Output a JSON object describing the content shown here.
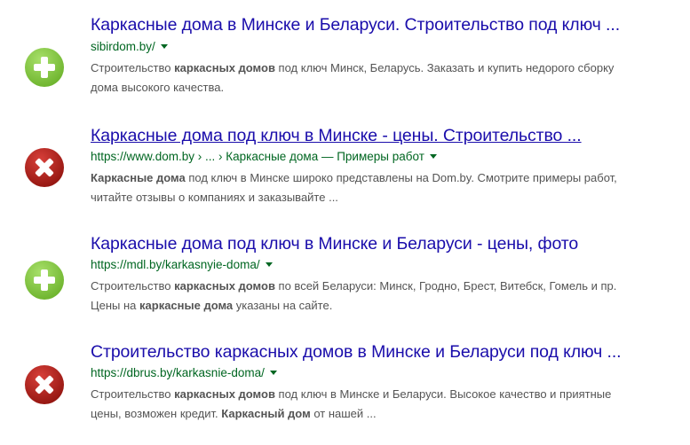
{
  "results": [
    {
      "status_icon": "plus-icon",
      "status_color": "#7cc242",
      "title": "Каркасные дома в Минске и Беларуси. Строительство под ключ ...",
      "url": "sibirdom.by/",
      "snippet_line1": [
        {
          "text": "Строительство ",
          "bold": false
        },
        {
          "text": "каркасных домов",
          "bold": true
        },
        {
          "text": " под ключ Минск, Беларусь. Заказать и купить недорого сборку",
          "bold": false
        }
      ],
      "snippet_line2": [
        {
          "text": "дома высокого качества.",
          "bold": false
        }
      ]
    },
    {
      "status_icon": "x-icon",
      "status_color": "#b0221c",
      "title": "Каркасные дома под ключ в Минске - цены. Строительство ...",
      "url": "https://www.dom.by › ... › Каркасные дома — Примеры работ",
      "snippet_line1": [
        {
          "text": "Каркасные дома",
          "bold": true
        },
        {
          "text": " под ключ в Минске широко представлены на Dom.by. Смотрите примеры работ,",
          "bold": false
        }
      ],
      "snippet_line2": [
        {
          "text": "читайте отзывы о компаниях и заказывайте ...",
          "bold": false
        }
      ]
    },
    {
      "status_icon": "plus-icon",
      "status_color": "#7cc242",
      "title": "Каркасные дома под ключ в Минске и Беларуси - цены, фото",
      "url": "https://mdl.by/karkasnyie-doma/",
      "snippet_line1": [
        {
          "text": "Строительство ",
          "bold": false
        },
        {
          "text": "каркасных домов",
          "bold": true
        },
        {
          "text": " по всей Беларуси: Минск, Гродно, Брест, Витебск, Гомель и пр.",
          "bold": false
        }
      ],
      "snippet_line2": [
        {
          "text": "Цены на ",
          "bold": false
        },
        {
          "text": "каркасные дома",
          "bold": true
        },
        {
          "text": " указаны на сайте.",
          "bold": false
        }
      ]
    },
    {
      "status_icon": "x-icon",
      "status_color": "#b0221c",
      "title": "Строительство каркасных домов в Минске и Беларуси под ключ ...",
      "url": "https://dbrus.by/karkasnie-doma/",
      "snippet_line1": [
        {
          "text": "Строительство ",
          "bold": false
        },
        {
          "text": "каркасных домов",
          "bold": true
        },
        {
          "text": " под ключ в Минске и Беларуси. Высокое качество и приятные",
          "bold": false
        }
      ],
      "snippet_line2": [
        {
          "text": "цены, возможен кредит. ",
          "bold": false
        },
        {
          "text": "Каркасный дом",
          "bold": true
        },
        {
          "text": " от нашей ...",
          "bold": false
        }
      ]
    }
  ]
}
